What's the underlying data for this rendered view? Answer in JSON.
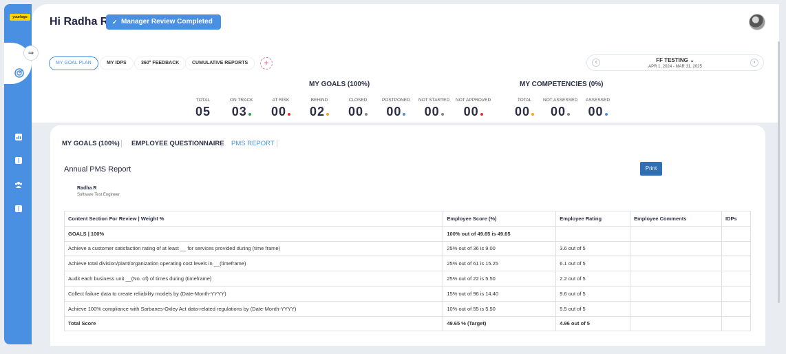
{
  "logo_text": "yourlogo",
  "greeting": "Hi Radha R",
  "status_badge": "Manager Review Completed",
  "tabs": [
    {
      "label": "MY GOAL PLAN"
    },
    {
      "label": "MY IDPS"
    },
    {
      "label": "360° FEEDBACK"
    },
    {
      "label": "CUMULATIVE REPORTS"
    }
  ],
  "add_tab": "+",
  "period": {
    "name": "FF TESTING",
    "range": "APR 1, 2024 - MAR 31, 2025",
    "prev": "‹",
    "next": "›"
  },
  "goals": {
    "title": "MY GOALS (100%)",
    "stats": [
      {
        "label": "TOTAL",
        "value": "05",
        "color": ""
      },
      {
        "label": "ON TRACK",
        "value": "03",
        "color": "#2ea44f"
      },
      {
        "label": "AT RISK",
        "value": "00",
        "color": "#e03131"
      },
      {
        "label": "BEHIND",
        "value": "02",
        "color": "#f5a623"
      },
      {
        "label": "CLOSED",
        "value": "00",
        "color": "#888888"
      },
      {
        "label": "POSTPONED",
        "value": "00",
        "color": "#4a90e2"
      },
      {
        "label": "NOT STARTED",
        "value": "00",
        "color": "#888888"
      },
      {
        "label": "NOT APPROVED",
        "value": "00",
        "color": "#e03131"
      }
    ]
  },
  "competencies": {
    "title": "MY COMPETENCIES (0%)",
    "stats": [
      {
        "label": "TOTAL",
        "value": "00",
        "color": "#f5a623"
      },
      {
        "label": "NOT ASSESSED",
        "value": "00",
        "color": "#888888"
      },
      {
        "label": "ASSESSED",
        "value": "00",
        "color": "#4a90e2"
      }
    ]
  },
  "panel_tabs": [
    {
      "label": "MY GOALS (100%)"
    },
    {
      "label": "EMPLOYEE QUESTIONNAIRE"
    },
    {
      "label": "PMS REPORT"
    }
  ],
  "report": {
    "title": "Annual PMS Report",
    "print_label": "Print",
    "employee_name": "Radha R",
    "employee_role": "Software Test Engineer",
    "columns": [
      "Content Section For Review | Weight %",
      "Employee Score (%)",
      "Employee Rating",
      "Employee Comments",
      "IDPs"
    ],
    "rows": [
      [
        "GOALS | 100%",
        "100% out of 49.65 is 49.65",
        "",
        "",
        ""
      ],
      [
        "Achieve a customer satisfaction rating of at least __ for services provided during (time frame)",
        "25% out of 36 is 9.00",
        "3.6 out of 5",
        "",
        ""
      ],
      [
        "Achieve total division/plant/organization operating cost levels in __(timeframe)",
        "25% out of 61 is 15.25",
        "6.1 out of 5",
        "",
        ""
      ],
      [
        "Audit each business unit __(No. of) of times during (timeframe)",
        "25% out of 22 is 5.50",
        "2.2 out of 5",
        "",
        ""
      ],
      [
        "Collect failure data to create reliability models by (Date-Month-YYYY)",
        "15% out of 96 is 14.40",
        "9.6 out of 5",
        "",
        ""
      ],
      [
        "Achieve 100% compliance with Sarbanes-Oxley Act data-related regulations by (Date-Month-YYYY)",
        "10% out of 55 is 5.50",
        "5.5 out of 5",
        "",
        ""
      ],
      [
        "Total Score",
        "49.65 % (Target)",
        "4.96 out of 5",
        "",
        ""
      ]
    ]
  },
  "colors": {
    "accent": "#4a90e2",
    "sidebar": "#4a90e2",
    "print": "#2f6fb3"
  }
}
